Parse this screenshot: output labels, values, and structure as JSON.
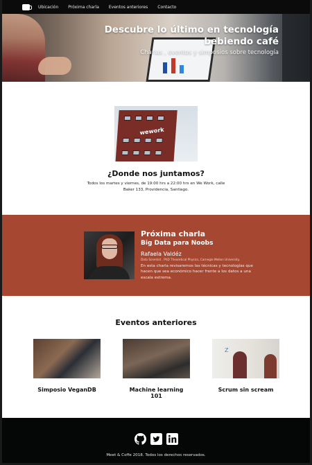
{
  "navbar": {
    "brand_icon": "coffee-cup-icon",
    "links": [
      "Ubicación",
      "Próxima charla",
      "Eventos anteriores",
      "Contacto"
    ]
  },
  "hero": {
    "title": "Descubre lo último en tecnología bebiendo café",
    "subtitle": "Charlas , eventos y simposios sobre tecnología"
  },
  "location": {
    "title": "¿Donde nos juntamos?",
    "description": "Todos los martes y viernes, de 19:00 hrs a 22:00 hrs en We Work, calle Baker 133, Providencia, Santiago.",
    "photo_sign": "wework"
  },
  "next_talk": {
    "label": "Próxima charla",
    "title": "Big Data para Noobs",
    "speaker": "Rafaela Valdéz",
    "role": "Data Scientist . PhD Theoretical Physics, Carnegie Mellon University.",
    "description": "En esta charla revisaremos las técnicas y tecnologías que hacen que sea económico hacer frente a los datos a una escala extrema.",
    "background_color": "#a64731"
  },
  "past_events": {
    "title": "Eventos anteriores",
    "items": [
      {
        "name": "Simposio VeganDB"
      },
      {
        "name": "Machine learning 101"
      },
      {
        "name": "Scrum sin scream"
      }
    ]
  },
  "footer": {
    "social_icons": [
      "github-icon",
      "twitter-icon",
      "linkedin-icon"
    ],
    "copyright": "Meet & Coffe 2018. Todos los derechos reservados."
  }
}
